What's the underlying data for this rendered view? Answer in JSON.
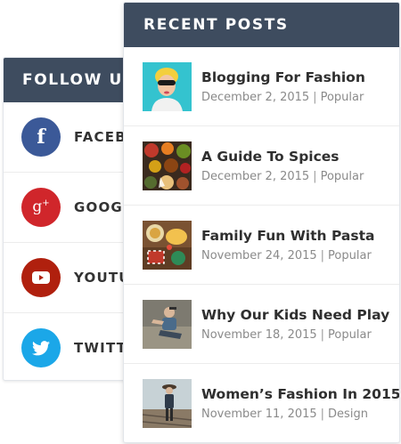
{
  "follow_widget": {
    "title": "FOLLOW US",
    "items": [
      {
        "label": "FACEBOOK",
        "icon": "facebook-icon",
        "glyph": "f",
        "color": "#3b5998"
      },
      {
        "label": "GOOGLE+",
        "icon": "google-plus-icon",
        "glyph": "g+",
        "color": "#d0262b"
      },
      {
        "label": "YOUTUBE",
        "icon": "youtube-icon",
        "glyph": "play",
        "color": "#b0200e"
      },
      {
        "label": "TWITTER",
        "icon": "twitter-icon",
        "glyph": "bird",
        "color": "#1ba7e8"
      }
    ]
  },
  "recent_widget": {
    "title": "RECENT POSTS",
    "separator": "|",
    "posts": [
      {
        "title": "Blogging For Fashion",
        "date": "December 2, 2015",
        "category": "Popular"
      },
      {
        "title": "A Guide To Spices",
        "date": "December 2, 2015",
        "category": "Popular"
      },
      {
        "title": "Family Fun With Pasta",
        "date": "November 24, 2015",
        "category": "Popular"
      },
      {
        "title": "Why Our Kids Need Play",
        "date": "November 18, 2015",
        "category": "Popular"
      },
      {
        "title": "Women’s Fashion In 2015",
        "date": "November 11, 2015",
        "category": "Design"
      }
    ]
  }
}
